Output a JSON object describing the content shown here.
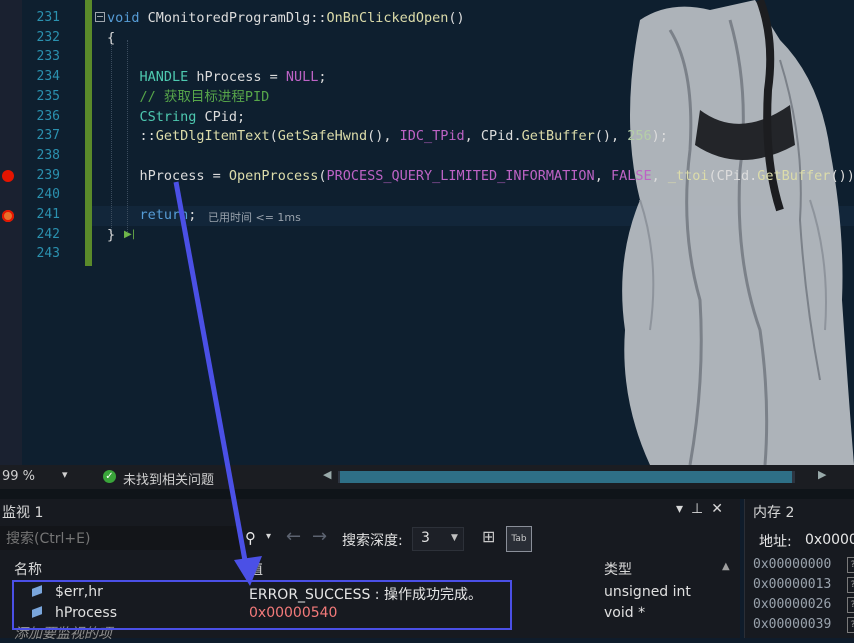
{
  "editor": {
    "lines": [
      {
        "num": "231",
        "tokens": [
          {
            "t": "void",
            "c": "kw"
          },
          {
            "t": " CMonitoredProgramDlg::"
          },
          {
            "t": "OnBnClickedOpen",
            "c": "fn"
          },
          {
            "t": "()"
          }
        ]
      },
      {
        "num": "232",
        "tokens": [
          {
            "t": "{"
          }
        ]
      },
      {
        "num": "233",
        "tokens": []
      },
      {
        "num": "234",
        "tokens": [
          {
            "t": "    "
          },
          {
            "t": "HANDLE",
            "c": "ty"
          },
          {
            "t": " hProcess = "
          },
          {
            "t": "NULL",
            "c": "mac"
          },
          {
            "t": ";"
          }
        ]
      },
      {
        "num": "235",
        "tokens": [
          {
            "t": "    "
          },
          {
            "t": "// 获取目标进程PID",
            "c": "cm"
          }
        ]
      },
      {
        "num": "236",
        "tokens": [
          {
            "t": "    "
          },
          {
            "t": "CString",
            "c": "ty"
          },
          {
            "t": " CPid;"
          }
        ]
      },
      {
        "num": "237",
        "tokens": [
          {
            "t": "    ::"
          },
          {
            "t": "GetDlgItemText",
            "c": "fn"
          },
          {
            "t": "("
          },
          {
            "t": "GetSafeHwnd",
            "c": "fn"
          },
          {
            "t": "(), "
          },
          {
            "t": "IDC_TPid",
            "c": "mac"
          },
          {
            "t": ", CPid."
          },
          {
            "t": "GetBuffer",
            "c": "fn"
          },
          {
            "t": "(), "
          },
          {
            "t": "256",
            "c": "num"
          },
          {
            "t": ");"
          }
        ]
      },
      {
        "num": "238",
        "tokens": []
      },
      {
        "num": "239",
        "tokens": [
          {
            "t": "    hProcess = "
          },
          {
            "t": "OpenProcess",
            "c": "fn"
          },
          {
            "t": "("
          },
          {
            "t": "PROCESS_QUERY_LIMITED_INFORMATION",
            "c": "mac"
          },
          {
            "t": ", "
          },
          {
            "t": "FALSE",
            "c": "mac"
          },
          {
            "t": ", "
          },
          {
            "t": "_ttoi",
            "c": "fn"
          },
          {
            "t": "(CPid."
          },
          {
            "t": "GetBuffer",
            "c": "fn"
          },
          {
            "t": "()));"
          }
        ]
      },
      {
        "num": "240",
        "tokens": []
      },
      {
        "num": "241",
        "tokens": [
          {
            "t": "    "
          },
          {
            "t": "return",
            "c": "kw"
          },
          {
            "t": ";"
          }
        ]
      },
      {
        "num": "242",
        "tokens": [
          {
            "t": "}"
          }
        ]
      },
      {
        "num": "243",
        "tokens": []
      }
    ],
    "elapsed_hint": "已用时间 <= 1ms",
    "breakpoint_lines": [
      "239",
      "241"
    ]
  },
  "statusbar": {
    "zoom": "99 %",
    "issues": "未找到相关问题"
  },
  "watch": {
    "title": "监视 1",
    "search_placeholder": "搜索(Ctrl+E)",
    "search_depth_label": "搜索深度:",
    "search_depth_value": "3",
    "columns": {
      "name": "名称",
      "value": "值",
      "type": "类型"
    },
    "rows": [
      {
        "name": "$err,hr",
        "value": "ERROR_SUCCESS : 操作成功完成。",
        "type": "unsigned int",
        "changed": false
      },
      {
        "name": "hProcess",
        "value": "0x00000540",
        "type": "void *",
        "changed": true
      }
    ],
    "add_item": "添加要监视的项"
  },
  "memory": {
    "title": "内存 2",
    "address_label": "地址:",
    "address_value": "0x0000",
    "rows": [
      "0x00000000",
      "0x00000013",
      "0x00000026",
      "0x00000039"
    ]
  },
  "colors": {
    "annotation": "#4b50e6",
    "breakpoint": "#e51400",
    "changed_value": "#f47a7a"
  }
}
